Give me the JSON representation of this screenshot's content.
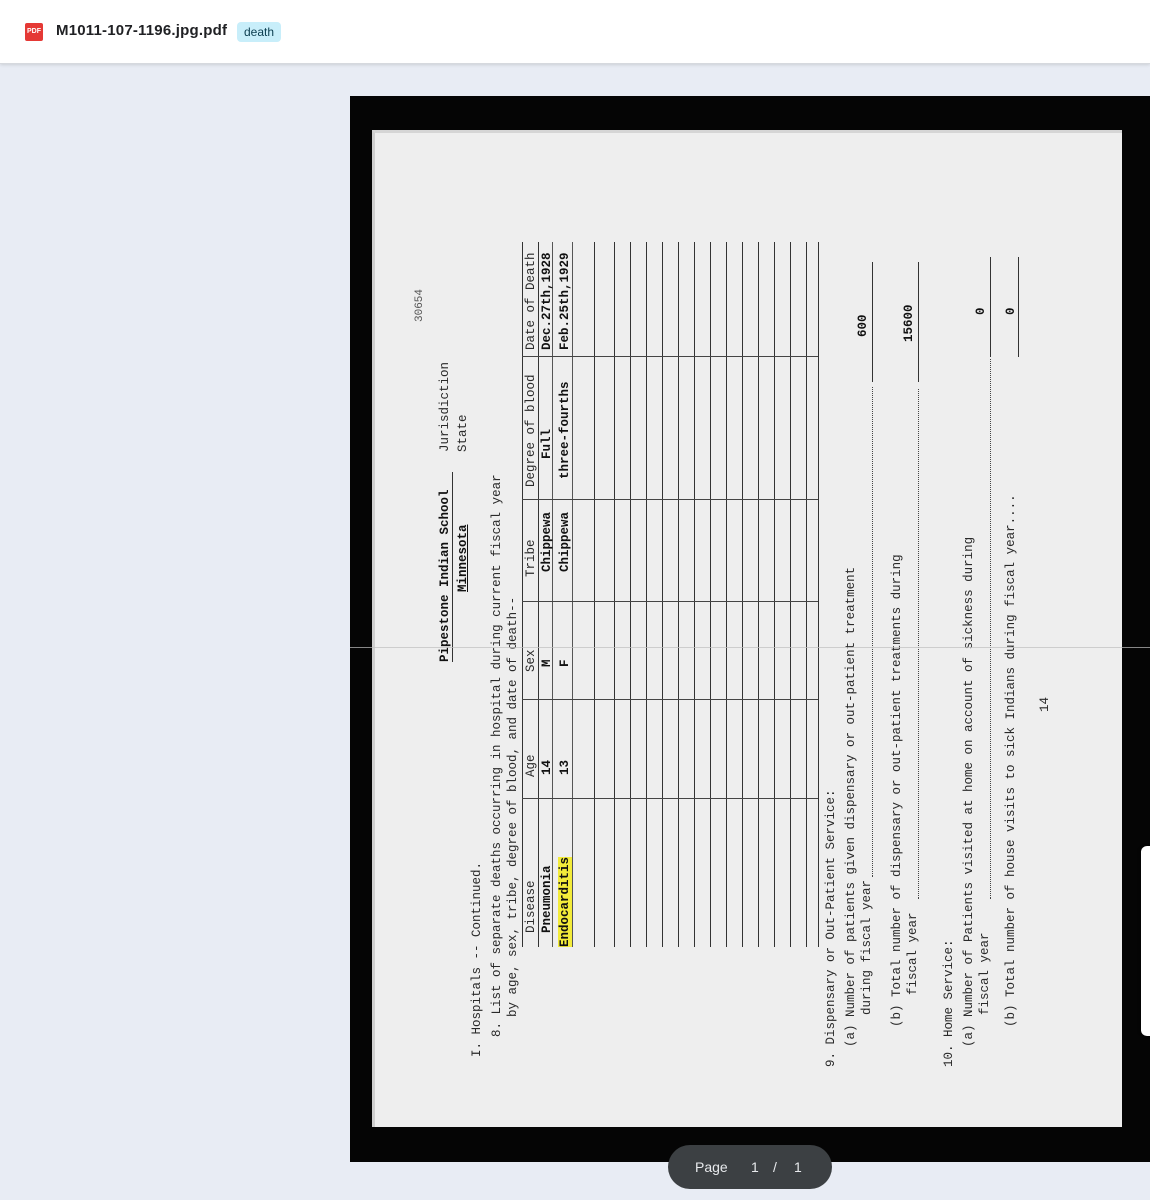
{
  "header": {
    "file_icon": "pdf-icon",
    "file_icon_label": "PDF",
    "file_name": "M1011-107-1196.jpg.pdf",
    "tag": "death"
  },
  "document": {
    "stamp": "30654",
    "school": "Pipestone Indian School",
    "state_value": "Minnesota",
    "jurisdiction_label": "Jurisdiction",
    "state_label": "State",
    "section": "I. Hospitals -- Continued.",
    "item8_line1": "8. List of separate deaths occurring in hospital during current fiscal year",
    "item8_line2": "by age, sex, tribe, degree of blood, and date of death--",
    "table": {
      "headers": [
        "Disease",
        "Age",
        "Sex",
        "Tribe",
        "Degree of blood",
        "Date of Death"
      ],
      "rows": [
        [
          "Pneumonia",
          "14",
          "M",
          "Chippewa",
          "Full",
          "Dec.27th,1928"
        ],
        [
          "Endocarditis",
          "13",
          "F",
          "Chippewa",
          "three-fourths",
          "Feb.25th,1929"
        ]
      ]
    },
    "item9": "9. Dispensary or Out-Patient Service:",
    "item9a_line1": "(a) Number of patients given dispensary or out-patient treatment",
    "item9a_line2": "during fiscal year",
    "item9a_value": "600",
    "item9b_line1": "(b) Total number of dispensary or out-patient treatments during",
    "item9b_line2": "fiscal year",
    "item9b_value": "15600",
    "item10": "10. Home Service:",
    "item10a_line1": "(a) Number of Patients visited at home on account of sickness during",
    "item10a_line2": "fiscal year",
    "item10a_value": "0",
    "item10b_line1": "(b) Total number of house visits to sick Indians during fiscal year....",
    "item10b_value": "0",
    "page_number": "14"
  },
  "pager": {
    "label": "Page",
    "current": "1",
    "separator": "/",
    "total": "1"
  },
  "colors": {
    "highlight": "#f3ec3a",
    "tag_bg": "#c8eefa",
    "pdf_red": "#e53935",
    "pager_bg": "#3c4043"
  }
}
